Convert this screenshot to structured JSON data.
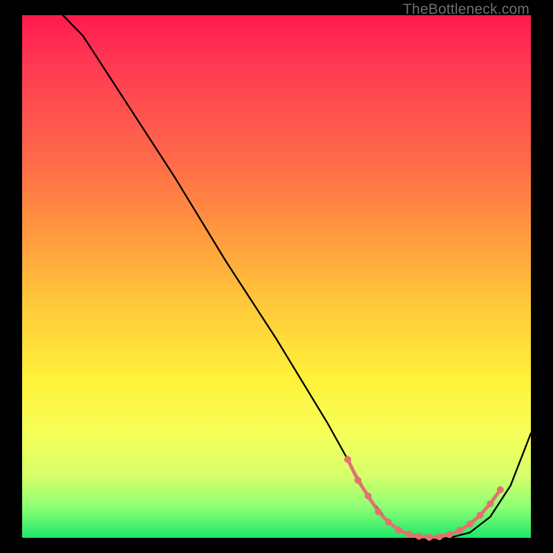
{
  "watermark": "TheBottleneck.com",
  "chart_data": {
    "type": "line",
    "title": "",
    "xlabel": "",
    "ylabel": "",
    "xlim": [
      0,
      100
    ],
    "ylim": [
      0,
      100
    ],
    "grid": false,
    "series": [
      {
        "name": "bottleneck-curve",
        "x": [
          8,
          12,
          20,
          30,
          40,
          50,
          60,
          64,
          68,
          72,
          76,
          80,
          84,
          88,
          92,
          96,
          100
        ],
        "y": [
          100,
          96,
          84,
          69,
          53,
          38,
          22,
          15,
          8,
          3,
          0.5,
          0,
          0,
          1,
          4,
          10,
          20
        ],
        "color": "#000000"
      }
    ],
    "markers": {
      "name": "highlighted-points",
      "color": "#e4716f",
      "points": [
        {
          "x": 64,
          "y": 15
        },
        {
          "x": 66,
          "y": 11
        },
        {
          "x": 68,
          "y": 8
        },
        {
          "x": 70,
          "y": 5
        },
        {
          "x": 72,
          "y": 3
        },
        {
          "x": 74,
          "y": 1.5
        },
        {
          "x": 76,
          "y": 0.7
        },
        {
          "x": 78,
          "y": 0.3
        },
        {
          "x": 80,
          "y": 0.1
        },
        {
          "x": 82,
          "y": 0.2
        },
        {
          "x": 84,
          "y": 0.6
        },
        {
          "x": 86,
          "y": 1.4
        },
        {
          "x": 88,
          "y": 2.6
        },
        {
          "x": 90,
          "y": 4.3
        },
        {
          "x": 92,
          "y": 6.5
        },
        {
          "x": 94,
          "y": 9.2
        }
      ]
    }
  }
}
